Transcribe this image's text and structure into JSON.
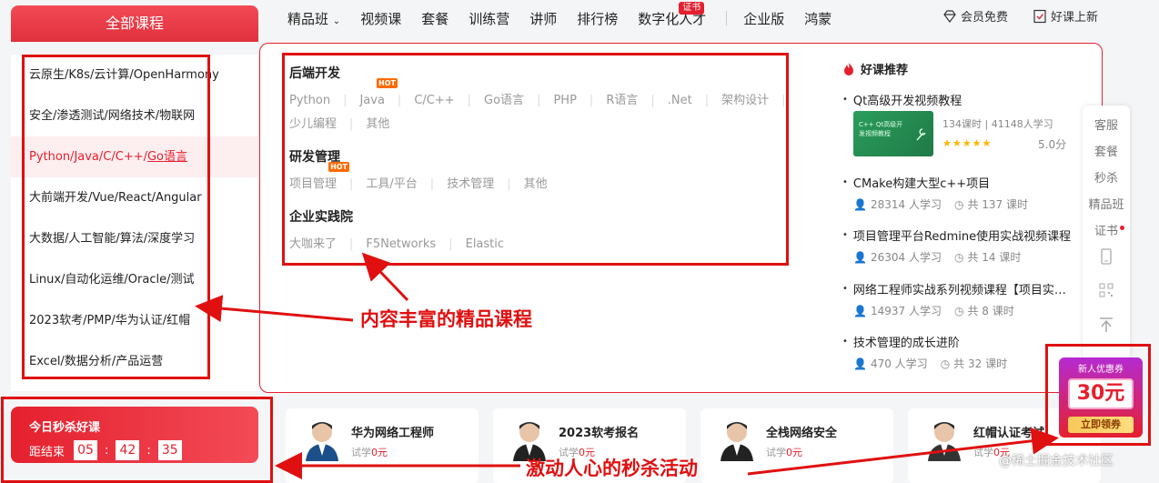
{
  "all_courses_label": "全部课程",
  "topnav": {
    "items": [
      "精品班",
      "视频课",
      "套餐",
      "训练营",
      "讲师",
      "排行榜",
      "数字化人才",
      "企业版",
      "鸿蒙"
    ],
    "cert_badge": "证书",
    "member_free": "会员免费",
    "new_courses": "好课上新"
  },
  "sidebar": {
    "items": [
      "云原生/K8s/云计算/OpenHarmony",
      "安全/渗透测试/网络技术/物联网",
      "Python/Java/C/C++/",
      "大前端开发/Vue/React/Angular",
      "大数据/人工智能/算法/深度学习",
      "Linux/自动化运维/Oracle/测试",
      "2023软考/PMP/华为认证/红帽",
      "Excel/数据分析/产品运营"
    ],
    "active_suffix": "Go语言"
  },
  "dropdown": {
    "categories": [
      {
        "title": "后端开发",
        "row1": [
          "Python",
          "Java",
          "C/C++",
          "Go语言",
          "PHP",
          "R语言",
          ".Net",
          "架构设计"
        ],
        "row2": [
          "少儿编程",
          "其他"
        ]
      },
      {
        "title": "研发管理",
        "row1": [
          "项目管理",
          "工具/平台",
          "技术管理",
          "其他"
        ]
      },
      {
        "title": "企业实践院",
        "row1": [
          "大咖来了",
          "F5Networks",
          "Elastic"
        ]
      }
    ],
    "hot_label": "HOT",
    "recommend": {
      "title": "好课推荐",
      "featured": {
        "title": "Qt高级开发视频教程",
        "thumb_text": "C++ Qt高级开\n发视频教程",
        "stats": "134课时 | 41148人学习",
        "rating": "5.0分",
        "stars": 5
      },
      "items": [
        {
          "title": "CMake构建大型c++项目",
          "learners": "28314 人学习",
          "lessons": "共 137 课时"
        },
        {
          "title": "项目管理平台Redmine使用实战视频课程",
          "learners": "26304 人学习",
          "lessons": "共 14 课时"
        },
        {
          "title": "网络工程师实战系列视频课程【项目实战】",
          "learners": "14937 人学习",
          "lessons": "共 8 课时"
        },
        {
          "title": "技术管理的成长进阶",
          "learners": "470 人学习",
          "lessons": "共 32 课时"
        }
      ]
    }
  },
  "right_rail": {
    "items": [
      "客服",
      "套餐",
      "秒杀",
      "精品班",
      "证书"
    ]
  },
  "flash_sale": {
    "title": "今日秒杀好课",
    "countdown_label": "距结束",
    "hours": "05",
    "minutes": "42",
    "seconds": "35"
  },
  "cards": [
    {
      "title": "华为网络工程师",
      "trial_label": "试学",
      "price": "0元"
    },
    {
      "title": "2023软考报名",
      "trial_label": "试学",
      "price": "0元"
    },
    {
      "title": "全栈网络安全",
      "trial_label": "试学",
      "price": "0元"
    },
    {
      "title": "红帽认证考试",
      "trial_label": "试学",
      "price": "0元"
    }
  ],
  "coupon": {
    "label": "新人优惠券",
    "amount": "30元",
    "action": "立即领券"
  },
  "annotations": {
    "content": "内容丰富的精品课程",
    "flash": "激动人心的秒杀活动"
  },
  "watermark": "@稀土掘金技术社区",
  "colors": {
    "brand": "#e5202e",
    "annotation": "#e01010",
    "hot": "#ff6a00",
    "star": "#ffb400"
  }
}
